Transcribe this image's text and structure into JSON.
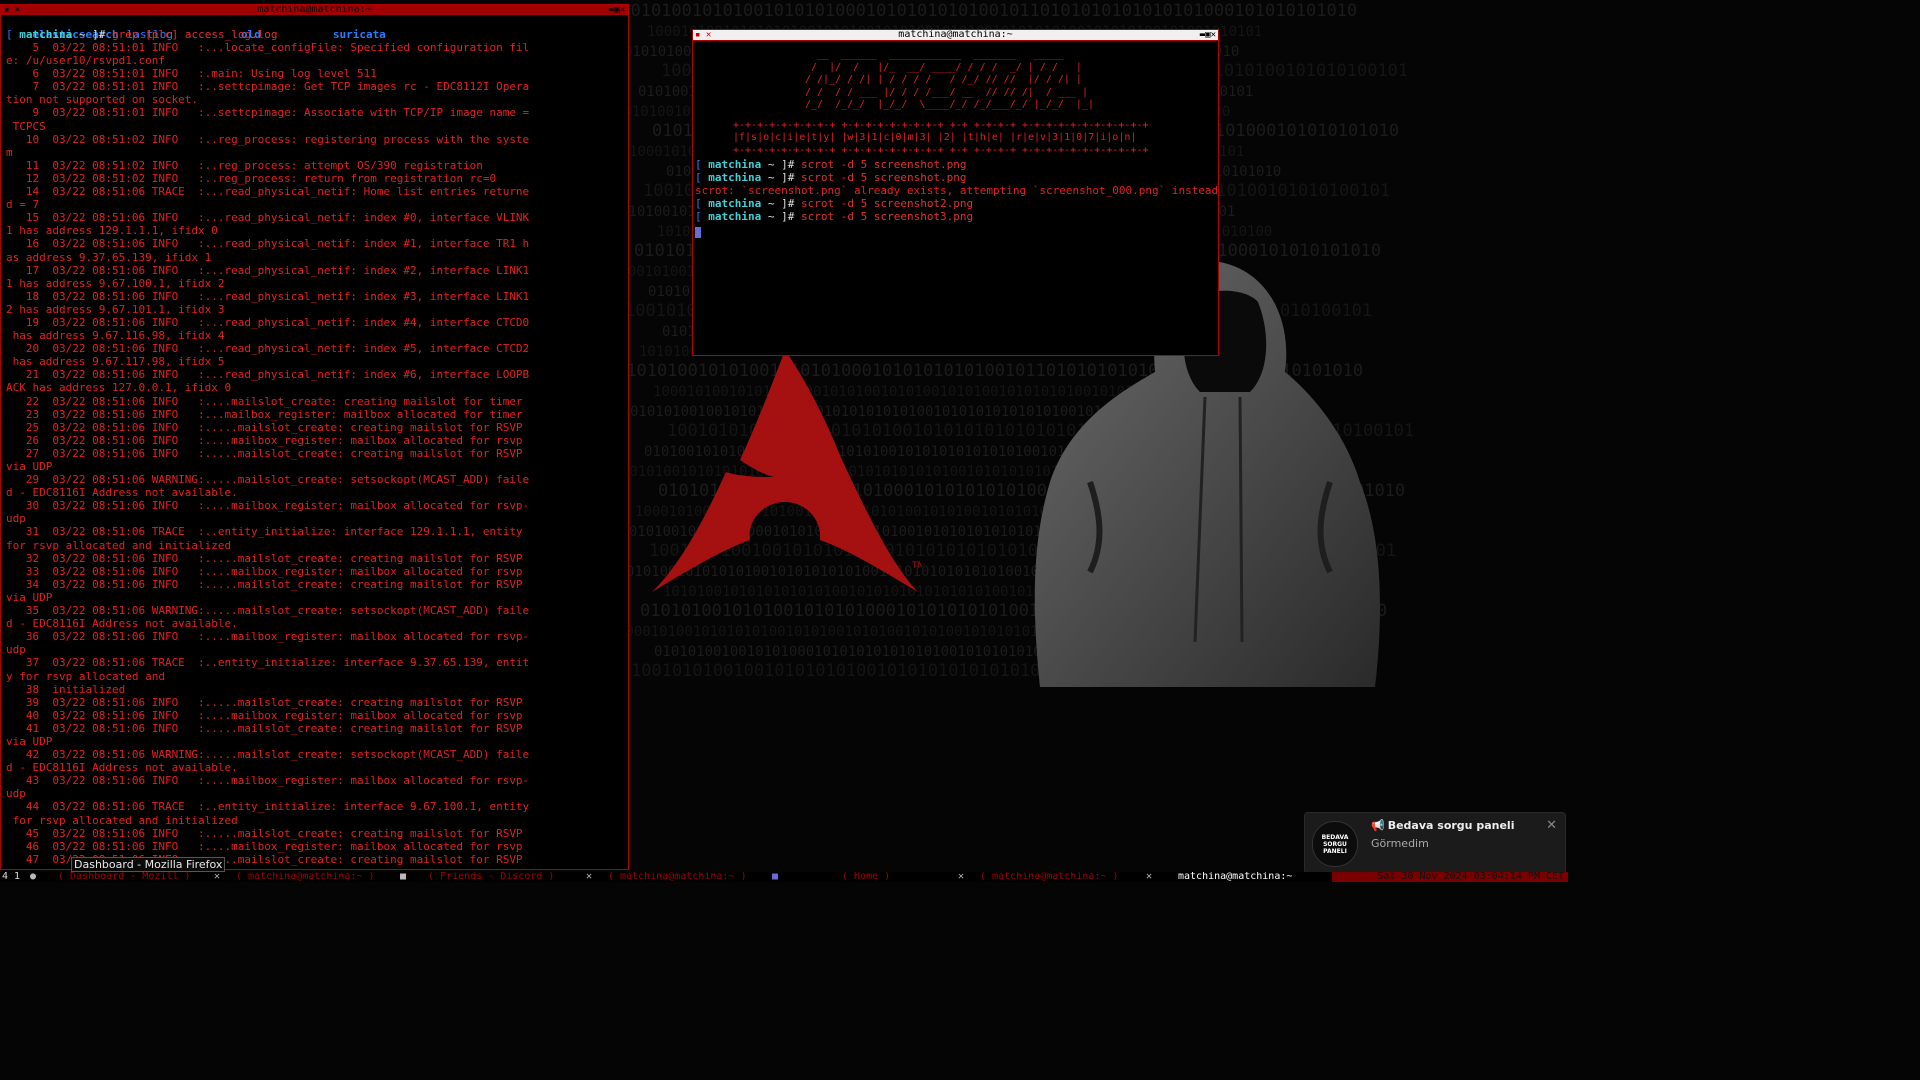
{
  "left_terminal": {
    "title": "matchina@matchina:~",
    "ls_output": [
      "elasticsearch",
      "lastlog",
      "old",
      "suricata"
    ],
    "prompt": {
      "open": "[ ",
      "user": "matchina",
      "path": " ~ ]# ",
      "command": "grep [plc] access_log.log"
    },
    "log_lines": [
      "    5  03/22 08:51:01 INFO   :...locate_configFile: Specified configuration fil",
      "e: /u/user10/rsvpd1.conf",
      "    6  03/22 08:51:01 INFO   :.main: Using log level 511",
      "    7  03/22 08:51:01 INFO   :..settcpimage: Get TCP images rc - EDC8112I Opera",
      "tion not supported on socket.",
      "    9  03/22 08:51:01 INFO   :..settcpimage: Associate with TCP/IP image name =",
      " TCPCS",
      "   10  03/22 08:51:02 INFO   :..reg_process: registering process with the syste",
      "m",
      "   11  03/22 08:51:02 INFO   :..reg_process: attempt OS/390 registration",
      "   12  03/22 08:51:02 INFO   :..reg_process: return from registration rc=0",
      "   14  03/22 08:51:06 TRACE  :...read_physical_netif: Home list entries returne",
      "d = 7",
      "   15  03/22 08:51:06 INFO   :...read_physical_netif: index #0, interface VLINK",
      "1 has address 129.1.1.1, ifidx 0",
      "   16  03/22 08:51:06 INFO   :...read_physical_netif: index #1, interface TR1 h",
      "as address 9.37.65.139, ifidx 1",
      "   17  03/22 08:51:06 INFO   :...read_physical_netif: index #2, interface LINK1",
      "1 has address 9.67.100.1, ifidx 2",
      "   18  03/22 08:51:06 INFO   :...read_physical_netif: index #3, interface LINK1",
      "2 has address 9.67.101.1, ifidx 3",
      "   19  03/22 08:51:06 INFO   :...read_physical_netif: index #4, interface CTCD0",
      " has address 9.67.116.98, ifidx 4",
      "   20  03/22 08:51:06 INFO   :...read_physical_netif: index #5, interface CTCD2",
      " has address 9.67.117.98, ifidx 5",
      "   21  03/22 08:51:06 INFO   :...read_physical_netif: index #6, interface LOOPB",
      "ACK has address 127.0.0.1, ifidx 0",
      "   22  03/22 08:51:06 INFO   :....mailslot_create: creating mailslot for timer",
      "   23  03/22 08:51:06 INFO   :...mailbox_register: mailbox allocated for timer",
      "   25  03/22 08:51:06 INFO   :.....mailslot_create: creating mailslot for RSVP",
      "   26  03/22 08:51:06 INFO   :....mailbox_register: mailbox allocated for rsvp",
      "   27  03/22 08:51:06 INFO   :.....mailslot_create: creating mailslot for RSVP",
      "via UDP",
      "   29  03/22 08:51:06 WARNING:.....mailslot_create: setsockopt(MCAST_ADD) faile",
      "d - EDC8116I Address not available.",
      "   30  03/22 08:51:06 INFO   :....mailbox_register: mailbox allocated for rsvp-",
      "udp",
      "   31  03/22 08:51:06 TRACE  :..entity_initialize: interface 129.1.1.1, entity",
      "for rsvp allocated and initialized",
      "   32  03/22 08:51:06 INFO   :.....mailslot_create: creating mailslot for RSVP",
      "   33  03/22 08:51:06 INFO   :....mailbox_register: mailbox allocated for rsvp",
      "   34  03/22 08:51:06 INFO   :.....mailslot_create: creating mailslot for RSVP",
      "via UDP",
      "   35  03/22 08:51:06 WARNING:.....mailslot_create: setsockopt(MCAST_ADD) faile",
      "d - EDC8116I Address not available.",
      "   36  03/22 08:51:06 INFO   :....mailbox_register: mailbox allocated for rsvp-",
      "udp",
      "   37  03/22 08:51:06 TRACE  :..entity_initialize: interface 9.37.65.139, entit",
      "y for rsvp allocated and",
      "   38  initialized",
      "   39  03/22 08:51:06 INFO   :.....mailslot_create: creating mailslot for RSVP",
      "   40  03/22 08:51:06 INFO   :....mailbox_register: mailbox allocated for rsvp",
      "   41  03/22 08:51:06 INFO   :.....mailslot_create: creating mailslot for RSVP",
      "via UDP",
      "   42  03/22 08:51:06 WARNING:.....mailslot_create: setsockopt(MCAST_ADD) faile",
      "d - EDC8116I Address not available.",
      "   43  03/22 08:51:06 INFO   :....mailbox_register: mailbox allocated for rsvp-",
      "udp",
      "   44  03/22 08:51:06 TRACE  :..entity_initialize: interface 9.67.100.1, entity",
      " for rsvp allocated and initialized",
      "   45  03/22 08:51:06 INFO   :.....mailslot_create: creating mailslot for RSVP",
      "   46  03/22 08:51:06 INFO   :....mailbox_register: mailbox allocated for rsvp",
      "   47  03/22 08:51:06 INFO   :.....mailslot_create: creating mailslot for RSVP"
    ],
    "hover_tooltip": "Dashboard - Mozilla Firefox"
  },
  "right_terminal": {
    "title": "matchina@matchina:~",
    "figlet_banner": "  __  ______  ____________  _______   _____\n /  |/  /   |/_  __/ ____/ / / /  _/ | / /   |\n/ /|_/ / /| | / / / /   / /_/ // //  |/ / /| |\n/ /  / / ___ |/ / / /___/ __  // // /|  / ___ |\n/_/  /_/_/  |_/_/  \\____/_/ /_/___/_/ |_/_/  |_|",
    "box_banner": "+-+-+-+-+-+-+-+-+ +-+-+-+-+-+-+-+-+ +-+ +-+-+-+ +-+-+-+-+-+-+-+-+-+-+\n|f|s|o|c|i|e|t|y| |w|3|1|c|0|m|3| |2| |t|h|e| |r|e|v|3|1|0|7|i|o|n|\n+-+-+-+-+-+-+-+-+ +-+-+-+-+-+-+-+-+ +-+ +-+-+-+ +-+-+-+-+-+-+-+-+-+-+",
    "prompt_open": "[ ",
    "prompt_user": "matchina",
    "prompt_path": " ~ ]# ",
    "commands": [
      "scrot -d 5 screenshot.png",
      "scrot -d 5 screenshot.png"
    ],
    "error_line": "scrot: `screenshot.png` already exists, attempting `screenshot_000.png` instead",
    "commands_after": [
      "scrot -d 5 screenshot2.png",
      "scrot -d 5 screenshot3.png"
    ]
  },
  "wallpaper": {
    "logo_mark": "TM",
    "binary_rows": [
      "0101010010101001010101000101010101010010110101010101010101000101010101010",
      "1000101001010101010010101001010100101010010101010100101010100101001010101",
      "0101010010010101000101010101010101001010101010101010010101000101010101010",
      "1001010100100101010101001010101010101010101001010101001010100101010100101",
      "0101001010101010010101010101001010101010101010010101010101010101010100101",
      "1010100101010101010100101010101010101010010101010101010101001010101010100"
    ],
    "accent_red": "#b31212"
  },
  "notification": {
    "title": "Bedava sorgu paneli",
    "body": "Görmedim",
    "avatar_text": "BEDAVA SORGU PANELI"
  },
  "taskbar": {
    "workspace": "4 1 ",
    "items": [
      "Dashboard - Mozill",
      "matchina@matchina:~",
      "Friends - Discord",
      "matchina@matchina:~",
      "Home",
      "matchina@matchina:~"
    ],
    "active_title": "matchina@matchina:~",
    "clock": "Sat 30 Nov 2024 03:04:14 PM CET"
  }
}
